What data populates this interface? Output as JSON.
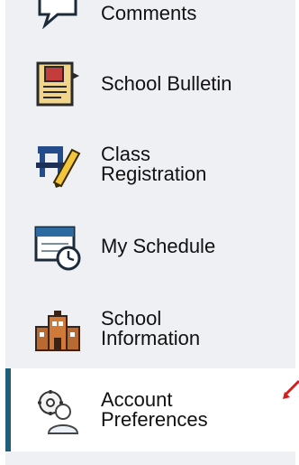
{
  "nav": {
    "items": [
      {
        "label": "Comments",
        "icon": "comments-icon"
      },
      {
        "label": "School Bulletin",
        "icon": "bulletin-icon"
      },
      {
        "label_line1": "Class",
        "label_line2": "Registration",
        "icon": "class-registration-icon"
      },
      {
        "label": "My Schedule",
        "icon": "calendar-clock-icon"
      },
      {
        "label_line1": "School",
        "label_line2": "Information",
        "icon": "school-building-icon"
      },
      {
        "label_line1": "Account",
        "label_line2": "Preferences",
        "icon": "account-preferences-icon",
        "active": true
      }
    ]
  },
  "colors": {
    "sidebar_bg": "#eef0f3",
    "active_bg": "#ffffff",
    "active_border": "#1f5f7a",
    "annotation_arrow": "#d81b1b"
  }
}
